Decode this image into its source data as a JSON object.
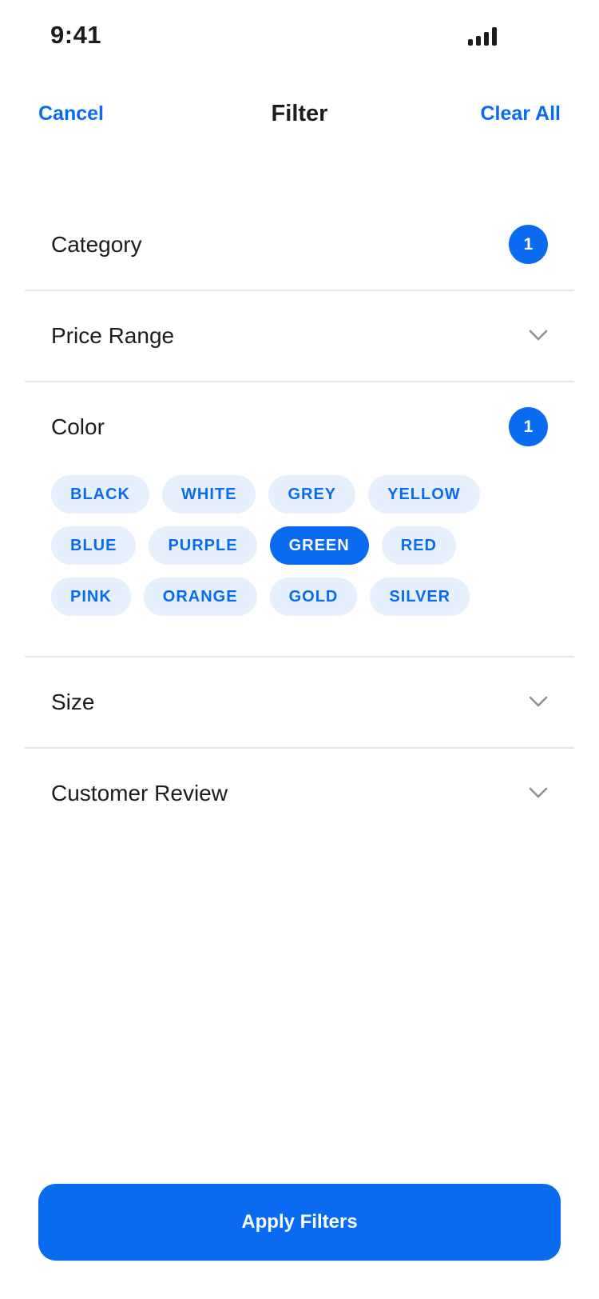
{
  "status": {
    "time": "9:41"
  },
  "nav": {
    "cancel": "Cancel",
    "title": "Filter",
    "clear_all": "Clear All"
  },
  "sections": [
    {
      "title": "Category",
      "badge": "1"
    },
    {
      "title": "Price Range"
    },
    {
      "title": "Color",
      "badge": "1",
      "chips": [
        {
          "label": "BLACK",
          "selected": false
        },
        {
          "label": "WHITE",
          "selected": false
        },
        {
          "label": "GREY",
          "selected": false
        },
        {
          "label": "YELLOW",
          "selected": false
        },
        {
          "label": "BLUE",
          "selected": false
        },
        {
          "label": "PURPLE",
          "selected": false
        },
        {
          "label": "GREEN",
          "selected": true
        },
        {
          "label": "RED",
          "selected": false
        },
        {
          "label": "PINK",
          "selected": false
        },
        {
          "label": "ORANGE",
          "selected": false
        },
        {
          "label": "GOLD",
          "selected": false
        },
        {
          "label": "SILVER",
          "selected": false
        }
      ]
    },
    {
      "title": "Size"
    },
    {
      "title": "Customer Review"
    }
  ],
  "apply_button": {
    "label": "Apply Filters"
  },
  "colors": {
    "accent": "#0a6bf0",
    "chip_bg": "#e6effc",
    "divider": "#e6e6e9",
    "text": "#1c1c1e"
  }
}
